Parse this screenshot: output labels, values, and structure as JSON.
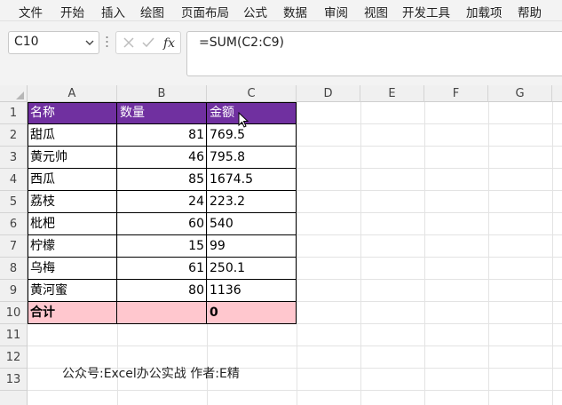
{
  "menu": {
    "items": [
      "文件",
      "开始",
      "插入",
      "绘图",
      "页面布局",
      "公式",
      "数据",
      "审阅",
      "视图",
      "开发工具",
      "加载项",
      "帮助"
    ]
  },
  "formula_bar": {
    "name_box": "C10",
    "formula": "=SUM(C2:C9)",
    "icons": [
      "cancel-icon",
      "enter-icon",
      "fx-icon"
    ]
  },
  "grid": {
    "columns": [
      "A",
      "B",
      "C",
      "D",
      "E",
      "F",
      "G"
    ],
    "rows": [
      "1",
      "2",
      "3",
      "4",
      "5",
      "6",
      "7",
      "8",
      "9",
      "10",
      "11",
      "12",
      "13"
    ],
    "table": {
      "header": [
        "名称",
        "数量",
        "金额"
      ],
      "rows": [
        [
          "甜瓜",
          "81",
          "769.5"
        ],
        [
          "黄元帅",
          "46",
          "795.8"
        ],
        [
          "西瓜",
          "85",
          "1674.5"
        ],
        [
          "荔枝",
          "24",
          "223.2"
        ],
        [
          "枇杷",
          "60",
          "540"
        ],
        [
          "柠檬",
          "15",
          "99"
        ],
        [
          "乌梅",
          "61",
          "250.1"
        ],
        [
          "黄河蜜",
          "80",
          "1136"
        ]
      ],
      "total": [
        "合计",
        "",
        "0"
      ]
    },
    "header_color": "#7030a0",
    "total_color": "#ffc7ce"
  },
  "note": "公众号:Excel办公实战  作者:E精"
}
